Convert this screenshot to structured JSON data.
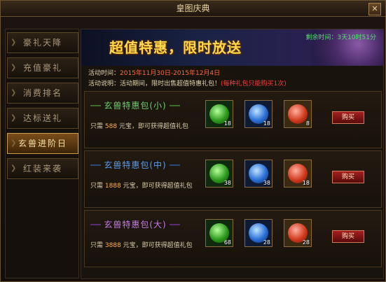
{
  "window": {
    "title": "皇图庆典",
    "close_glyph": "✕"
  },
  "sidebar": {
    "items": [
      {
        "label": "豪礼天降"
      },
      {
        "label": "充值豪礼"
      },
      {
        "label": "消费排名"
      },
      {
        "label": "达标送礼"
      },
      {
        "label": "玄兽进阶日"
      },
      {
        "label": "红装来袭"
      }
    ],
    "active_index": 4
  },
  "banner": {
    "slogan": "超值特惠，限时放送",
    "countdown": "剩余时间：3天10时51分"
  },
  "activity": {
    "time_label": "活动时间：",
    "time_value": "2015年11月30日-2015年12月4日",
    "desc_label": "活动说明：",
    "desc_value": "活动期间，限时出售超值特惠礼包！",
    "desc_note": "(每种礼包只能购买1次)"
  },
  "packs": [
    {
      "name": "玄兽特惠包(小)",
      "price_prefix": "只需",
      "price": "588",
      "price_suffix": "元宝，即可获得超值礼包",
      "buy_label": "购买",
      "color": "#6bd06b",
      "items": [
        {
          "icon": "green-orb-icon",
          "count": "18"
        },
        {
          "icon": "blue-orb-icon",
          "count": "18"
        },
        {
          "icon": "red-fruit-icon",
          "count": "8"
        }
      ]
    },
    {
      "name": "玄兽特惠包(中)",
      "price_prefix": "只需",
      "price": "1888",
      "price_suffix": "元宝，即可获得超值礼包",
      "buy_label": "购买",
      "color": "#5a9cf0",
      "items": [
        {
          "icon": "green-orb-icon",
          "count": "38"
        },
        {
          "icon": "blue-orb-icon",
          "count": "38"
        },
        {
          "icon": "red-fruit-icon",
          "count": "18"
        }
      ]
    },
    {
      "name": "玄兽特惠包(大)",
      "price_prefix": "只需",
      "price": "3888",
      "price_suffix": "元宝，即可获得超值礼包",
      "buy_label": "购买",
      "color": "#c77be8",
      "items": [
        {
          "icon": "green-orb-icon",
          "count": "68"
        },
        {
          "icon": "blue-orb-icon",
          "count": "28"
        },
        {
          "icon": "red-fruit-icon",
          "count": "28"
        }
      ]
    }
  ]
}
